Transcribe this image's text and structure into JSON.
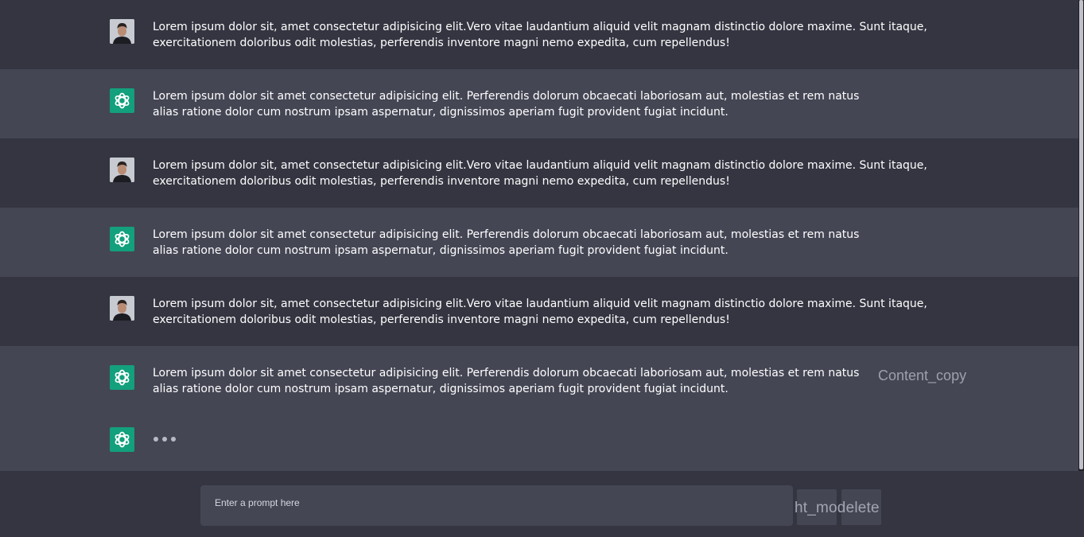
{
  "chat": {
    "messages": [
      {
        "role": "user",
        "lines": [
          "Lorem ipsum dolor sit, amet consectetur adipisicing elit.Vero vitae laudantium aliquid velit magnam distinctio dolore maxime. Sunt itaque,",
          "exercitationem doloribus odit molestias, perferendis inventore magni nemo expedita, cum repellendus!"
        ]
      },
      {
        "role": "assistant",
        "lines": [
          "Lorem ipsum dolor sit amet consectetur adipisicing elit. Perferendis dolorum obcaecati laboriosam aut, molestias et rem natus",
          "alias ratione dolor cum nostrum ipsam aspernatur, dignissimos aperiam fugit provident fugiat incidunt."
        ]
      },
      {
        "role": "user",
        "lines": [
          "Lorem ipsum dolor sit, amet consectetur adipisicing elit.Vero vitae laudantium aliquid velit magnam distinctio dolore maxime. Sunt itaque,",
          "exercitationem doloribus odit molestias, perferendis inventore magni nemo expedita, cum repellendus!"
        ]
      },
      {
        "role": "assistant",
        "lines": [
          "Lorem ipsum dolor sit amet consectetur adipisicing elit. Perferendis dolorum obcaecati laboriosam aut, molestias et rem natus",
          "alias ratione dolor cum nostrum ipsam aspernatur, dignissimos aperiam fugit provident fugiat incidunt."
        ]
      },
      {
        "role": "user",
        "lines": [
          "Lorem ipsum dolor sit, amet consectetur adipisicing elit.Vero vitae laudantium aliquid velit magnam distinctio dolore maxime. Sunt itaque,",
          "exercitationem doloribus odit molestias, perferendis inventore magni nemo expedita, cum repellendus!"
        ]
      },
      {
        "role": "assistant",
        "lines": [
          "Lorem ipsum dolor sit amet consectetur adipisicing elit. Perferendis dolorum obcaecati laboriosam aut, molestias et rem natus",
          "alias ratione dolor cum nostrum ipsam aspernatur, dignissimos aperiam fugit provident fugiat incidunt."
        ]
      }
    ],
    "copy_label": "Content_copy"
  },
  "composer": {
    "placeholder": "Enter a prompt here",
    "buttons_label": "ht_modelete"
  },
  "icons": {
    "user_avatar": "user-avatar-photo",
    "bot_avatar": "openai-logo-icon",
    "typing": "typing-dots-icon"
  },
  "colors": {
    "background": "#343541",
    "bot_row": "#444654",
    "bot_avatar_bg": "#13a07c",
    "scrollbar_thumb": "#c0bfca"
  }
}
